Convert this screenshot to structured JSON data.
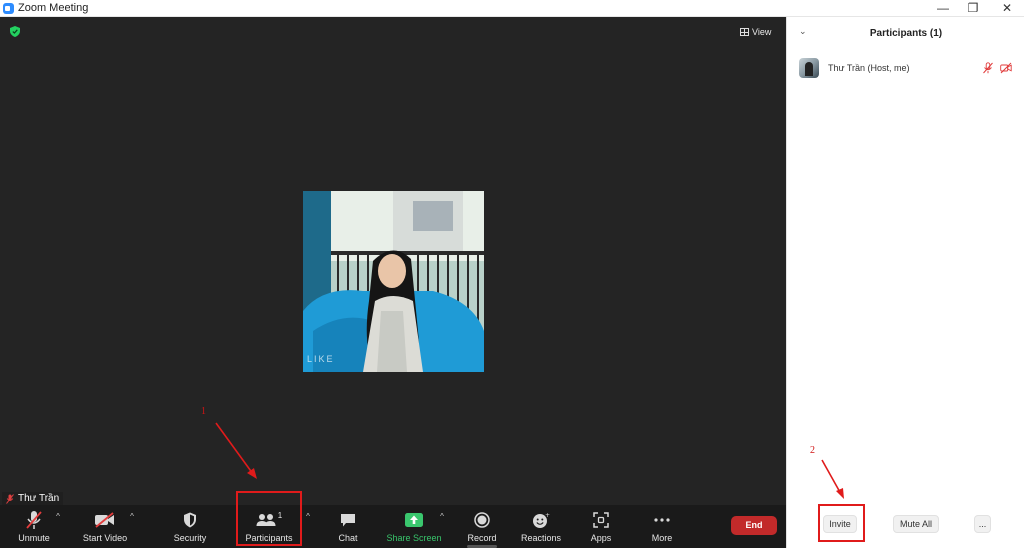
{
  "window": {
    "title": "Zoom Meeting",
    "minimize": "—",
    "restore": "❐",
    "close": "✕"
  },
  "video": {
    "view_label": "View",
    "participant_name": "Thư Trần",
    "watermark": "LIKE"
  },
  "toolbar": {
    "unmute": "Unmute",
    "start_video": "Start Video",
    "security": "Security",
    "participants": "Participants",
    "participants_count": "1",
    "chat": "Chat",
    "share_screen": "Share Screen",
    "record": "Record",
    "reactions": "Reactions",
    "apps": "Apps",
    "more": "More",
    "end": "End"
  },
  "annotations": {
    "one": "1",
    "two": "2"
  },
  "panel": {
    "title": "Participants (1)",
    "participants": [
      {
        "name": "Thư Trần (Host, me)"
      }
    ],
    "invite": "Invite",
    "mute_all": "Mute All",
    "more": "..."
  },
  "colors": {
    "accent_blue": "#2d8cff",
    "end_red": "#c22a2a",
    "share_green": "#38c56b",
    "annotation_red": "#e01b1b",
    "toolbar_bg": "#1a1a1a",
    "video_bg": "#242424"
  }
}
